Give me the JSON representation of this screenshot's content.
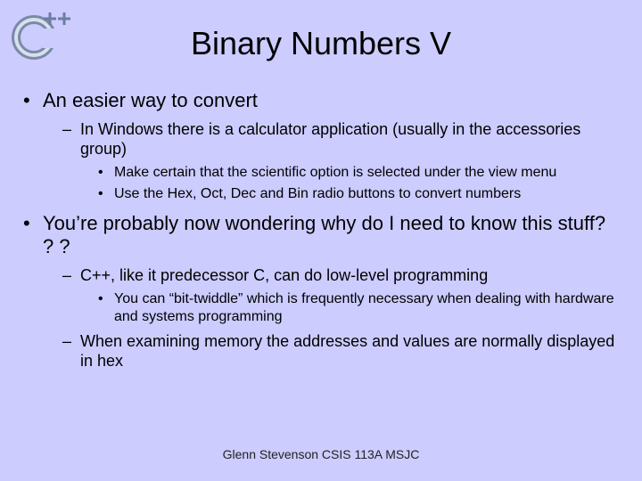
{
  "title": "Binary Numbers V",
  "footer": "Glenn Stevenson CSIS 113A MSJC",
  "bullets": [
    {
      "text": "An easier way to convert",
      "sub": [
        {
          "text": "In Windows there is a calculator application (usually in the accessories group)",
          "sub": [
            {
              "text": "Make certain that the scientific option is selected under the view menu"
            },
            {
              "text": "Use the Hex, Oct, Dec and Bin radio buttons to convert numbers"
            }
          ]
        }
      ]
    },
    {
      "text": "You’re probably now wondering why do I need to know this stuff? ? ?",
      "sub": [
        {
          "text": "C++, like it predecessor C, can do low-level programming",
          "sub": [
            {
              "text": "You can “bit-twiddle” which is frequently necessary when dealing with hardware and systems programming"
            }
          ]
        },
        {
          "text": "When examining memory the addresses and values are normally displayed in hex",
          "sub": []
        }
      ]
    }
  ]
}
